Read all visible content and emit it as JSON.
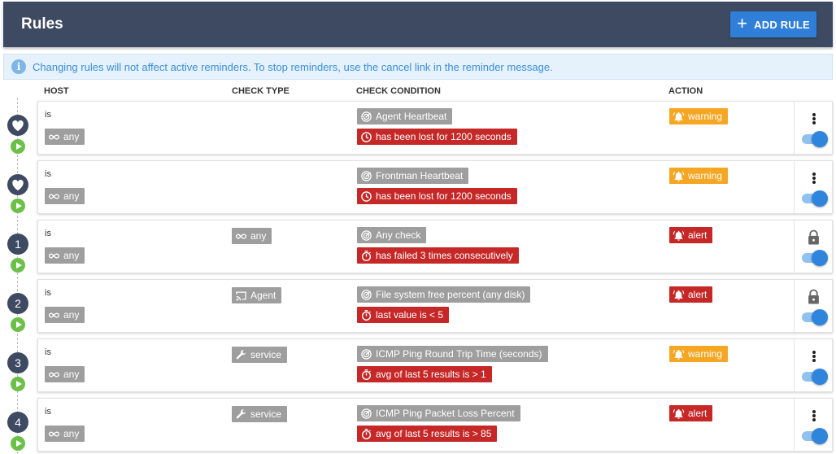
{
  "header": {
    "title": "Rules",
    "add_rule_label": "ADD RULE"
  },
  "info": {
    "message": "Changing rules will not affect active reminders. To stop reminders, use the cancel link in the reminder message."
  },
  "columns": {
    "host": "HOST",
    "check_type": "CHECK TYPE",
    "check_condition": "CHECK CONDITION",
    "action": "ACTION"
  },
  "rules": [
    {
      "marker": "heart",
      "marker_label": "",
      "host_prefix": "is",
      "host": "any",
      "check_type": "",
      "check_type_icon": "",
      "condition_name": "Agent Heartbeat",
      "condition_detail": "has been lost for 1200 seconds",
      "detail_icon": "clock-icon",
      "action": "warning",
      "action_color": "#f5a623",
      "control": "menu",
      "enabled": true
    },
    {
      "marker": "heart",
      "marker_label": "",
      "host_prefix": "is",
      "host": "any",
      "check_type": "",
      "check_type_icon": "",
      "condition_name": "Frontman Heartbeat",
      "condition_detail": "has been lost for 1200 seconds",
      "detail_icon": "clock-icon",
      "action": "warning",
      "action_color": "#f5a623",
      "control": "menu",
      "enabled": true
    },
    {
      "marker": "number",
      "marker_label": "1",
      "host_prefix": "is",
      "host": "any",
      "check_type": "any",
      "check_type_icon": "infinity-icon",
      "condition_name": "Any check",
      "condition_detail": "has failed 3 times consecutively",
      "detail_icon": "stopwatch-icon",
      "action": "alert",
      "action_color": "#c62828",
      "control": "lock",
      "enabled": true
    },
    {
      "marker": "number",
      "marker_label": "2",
      "host_prefix": "is",
      "host": "any",
      "check_type": "Agent",
      "check_type_icon": "cast-icon",
      "condition_name": "File system free percent (any disk)",
      "condition_detail": "last value is < 5",
      "detail_icon": "stopwatch-icon",
      "action": "alert",
      "action_color": "#c62828",
      "control": "lock",
      "enabled": true
    },
    {
      "marker": "number",
      "marker_label": "3",
      "host_prefix": "is",
      "host": "any",
      "check_type": "service",
      "check_type_icon": "wrench-icon",
      "condition_name": "ICMP Ping Round Trip Time (seconds)",
      "condition_detail": "avg of last 5 results is > 1",
      "detail_icon": "stopwatch-icon",
      "action": "warning",
      "action_color": "#f5a623",
      "control": "menu",
      "enabled": true
    },
    {
      "marker": "number",
      "marker_label": "4",
      "host_prefix": "is",
      "host": "any",
      "check_type": "service",
      "check_type_icon": "wrench-icon",
      "condition_name": "ICMP Ping Packet Loss Percent",
      "condition_detail": "avg of last 5 results is > 85",
      "detail_icon": "stopwatch-icon",
      "action": "alert",
      "action_color": "#c62828",
      "control": "menu",
      "enabled": true
    }
  ]
}
